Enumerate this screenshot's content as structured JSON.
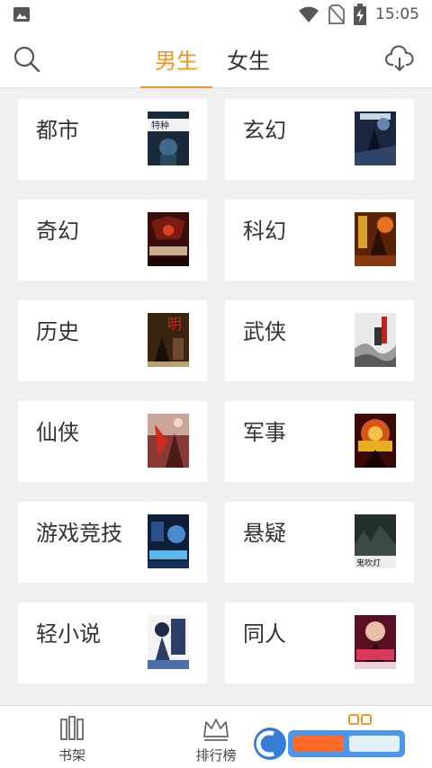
{
  "status_bar": {
    "time": "15:05"
  },
  "header": {
    "tabs": [
      {
        "label": "男生",
        "active": true
      },
      {
        "label": "女生",
        "active": false
      }
    ]
  },
  "categories": [
    {
      "label": "都市",
      "cover_title": "特种",
      "cover_color": "#1b2a3a"
    },
    {
      "label": "玄幻",
      "cover_title": "",
      "cover_color": "#1a2740"
    },
    {
      "label": "奇幻",
      "cover_title": "",
      "cover_color": "#3a0c0c"
    },
    {
      "label": "科幻",
      "cover_title": "",
      "cover_color": "#5a2206"
    },
    {
      "label": "历史",
      "cover_title": "明",
      "cover_color": "#3a2412"
    },
    {
      "label": "武侠",
      "cover_title": "",
      "cover_color": "#e9e9e9"
    },
    {
      "label": "仙侠",
      "cover_title": "",
      "cover_color": "#8a3a34"
    },
    {
      "label": "军事",
      "cover_title": "",
      "cover_color": "#3b0a06"
    },
    {
      "label": "游戏竞技",
      "cover_title": "",
      "cover_color": "#0e1d38"
    },
    {
      "label": "悬疑",
      "cover_title": "鬼吹灯",
      "cover_color": "#22302c"
    },
    {
      "label": "轻小说",
      "cover_title": "",
      "cover_color": "#2c3e66"
    },
    {
      "label": "同人",
      "cover_title": "",
      "cover_color": "#5a1022"
    }
  ],
  "bottom_nav": [
    {
      "label": "书架",
      "active": false
    },
    {
      "label": "排行榜",
      "active": false
    },
    {
      "label": "",
      "active": true
    }
  ],
  "colors": {
    "accent": "#f09422",
    "background": "#efefef"
  }
}
